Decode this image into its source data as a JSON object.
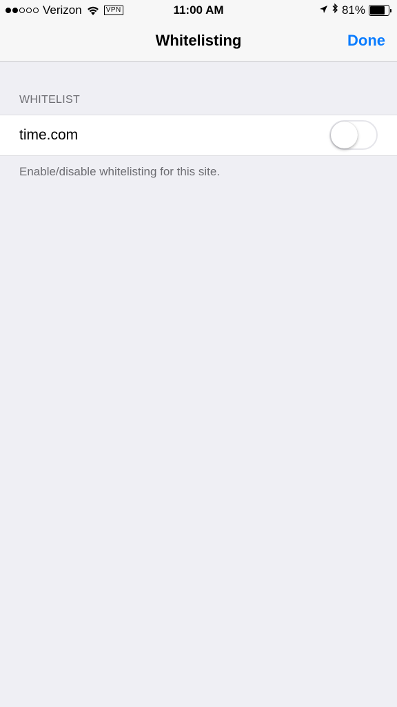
{
  "status_bar": {
    "signal_dots_filled": 2,
    "signal_dots_total": 5,
    "carrier": "Verizon",
    "wifi_icon": "wifi-icon",
    "vpn_label": "VPN",
    "time": "11:00 AM",
    "location_icon": "location-arrow-icon",
    "bluetooth_icon": "bluetooth-icon",
    "battery_percent_label": "81%",
    "battery_level": 0.81
  },
  "nav": {
    "title": "Whitelisting",
    "done_label": "Done",
    "accent_color": "#0a7cff"
  },
  "section": {
    "header": "WHITELIST",
    "row": {
      "label": "time.com",
      "toggle_on": false
    },
    "footer": "Enable/disable whitelisting for this site."
  },
  "colors": {
    "background": "#efeff4",
    "bar_background": "#f7f7f7",
    "secondary_text": "#6d6d72"
  }
}
